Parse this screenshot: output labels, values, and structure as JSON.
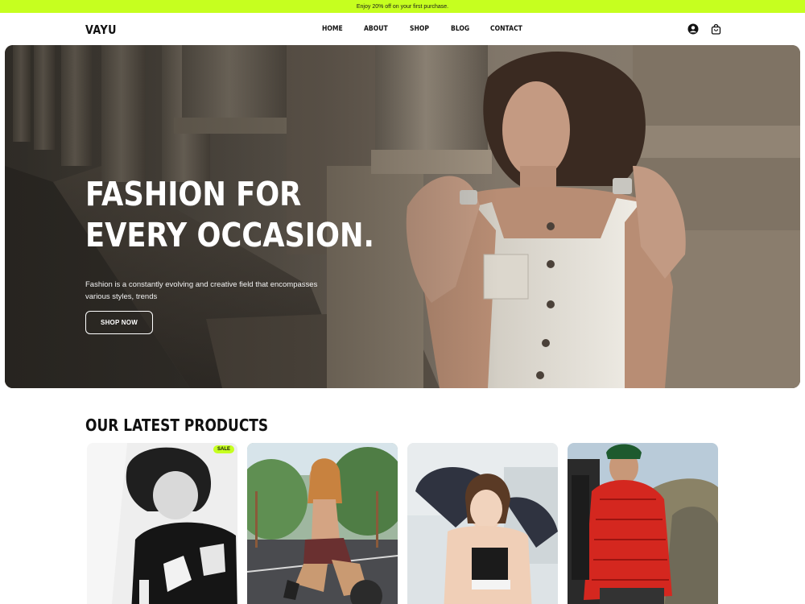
{
  "promo": {
    "text": "Enjoy 20% off on your first purchase."
  },
  "brand": {
    "logo": "VAYU"
  },
  "nav": {
    "links": [
      "HOME",
      "ABOUT",
      "SHOP",
      "BLOG",
      "CONTACT"
    ],
    "icons": [
      "user-icon",
      "cart-icon"
    ]
  },
  "hero": {
    "title_line1": "FASHION FOR",
    "title_line2": "EVERY OCCASION.",
    "description": "Fashion is a constantly evolving and creative field that encompasses various styles, trends",
    "cta_label": "SHOP NOW"
  },
  "products": {
    "title": "OUR LATEST PRODUCTS",
    "badge": "SALE"
  },
  "colors": {
    "accent": "#c6ff1f",
    "text": "#111111",
    "background": "#ffffff"
  }
}
